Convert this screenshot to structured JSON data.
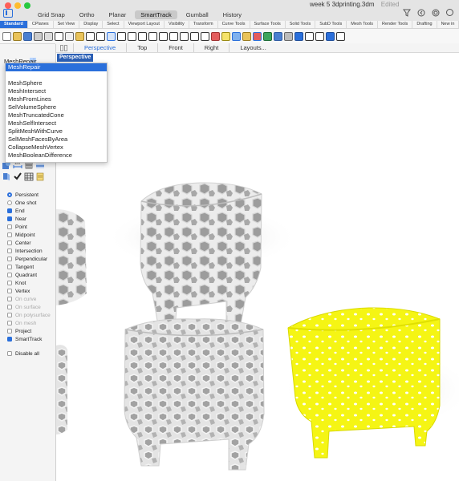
{
  "window": {
    "doc_title": "week 5 3dprinting.3dm",
    "doc_status": "Edited"
  },
  "osnap_tabs": [
    {
      "label": "Grid Snap",
      "active": false
    },
    {
      "label": "Ortho",
      "active": false
    },
    {
      "label": "Planar",
      "active": false
    },
    {
      "label": "SmartTrack",
      "active": true
    },
    {
      "label": "Gumball",
      "active": false
    },
    {
      "label": "History",
      "active": false
    }
  ],
  "toolbar_tabs": [
    "Standard",
    "CPlanes",
    "Set View",
    "Display",
    "Select",
    "Viewport Layout",
    "Visibility",
    "Transform",
    "Curve Tools",
    "Surface Tools",
    "Solid Tools",
    "SubD Tools",
    "Mesh Tools",
    "Render Tools",
    "Drafting",
    "New in"
  ],
  "toolbar_active_tab": "Standard",
  "command": {
    "typed": "MeshRep",
    "completion": "air"
  },
  "autocomplete": {
    "highlighted": "MeshRepair",
    "items": [
      "MeshSphere",
      "MeshIntersect",
      "MeshFromLines",
      "SelVolumeSphere",
      "MeshTruncatedCone",
      "MeshSelfIntersect",
      "SplitMeshWithCurve",
      "SelMeshFacesByArea",
      "CollapseMeshVertex",
      "MeshBooleanDifference"
    ]
  },
  "viewport_tabs": [
    {
      "label": "Perspective",
      "active": true
    },
    {
      "label": "Top",
      "active": false
    },
    {
      "label": "Front",
      "active": false
    },
    {
      "label": "Right",
      "active": false
    },
    {
      "label": "Layouts...",
      "active": false
    }
  ],
  "viewport_label": "Perspective",
  "osnap_mode": [
    {
      "label": "Persistent",
      "selected": true
    },
    {
      "label": "One shot",
      "selected": false
    }
  ],
  "osnaps": [
    {
      "label": "End",
      "checked": true,
      "enabled": true
    },
    {
      "label": "Near",
      "checked": true,
      "enabled": true
    },
    {
      "label": "Point",
      "checked": false,
      "enabled": true
    },
    {
      "label": "Midpoint",
      "checked": false,
      "enabled": true
    },
    {
      "label": "Center",
      "checked": false,
      "enabled": true
    },
    {
      "label": "Intersection",
      "checked": false,
      "enabled": true
    },
    {
      "label": "Perpendicular",
      "checked": false,
      "enabled": true
    },
    {
      "label": "Tangent",
      "checked": false,
      "enabled": true
    },
    {
      "label": "Quadrant",
      "checked": false,
      "enabled": true
    },
    {
      "label": "Knot",
      "checked": false,
      "enabled": true
    },
    {
      "label": "Vertex",
      "checked": false,
      "enabled": true
    },
    {
      "label": "On curve",
      "checked": false,
      "enabled": false
    },
    {
      "label": "On surface",
      "checked": false,
      "enabled": false
    },
    {
      "label": "On polysurface",
      "checked": false,
      "enabled": false
    },
    {
      "label": "On mesh",
      "checked": false,
      "enabled": false
    },
    {
      "label": "Project",
      "checked": false,
      "enabled": true
    },
    {
      "label": "SmartTrack",
      "checked": true,
      "enabled": true
    }
  ],
  "disable_all": "Disable all",
  "colors": {
    "accent": "#2a6fdb",
    "selection_yellow": "#f5f514",
    "mesh_white": "#e9e9e9"
  }
}
